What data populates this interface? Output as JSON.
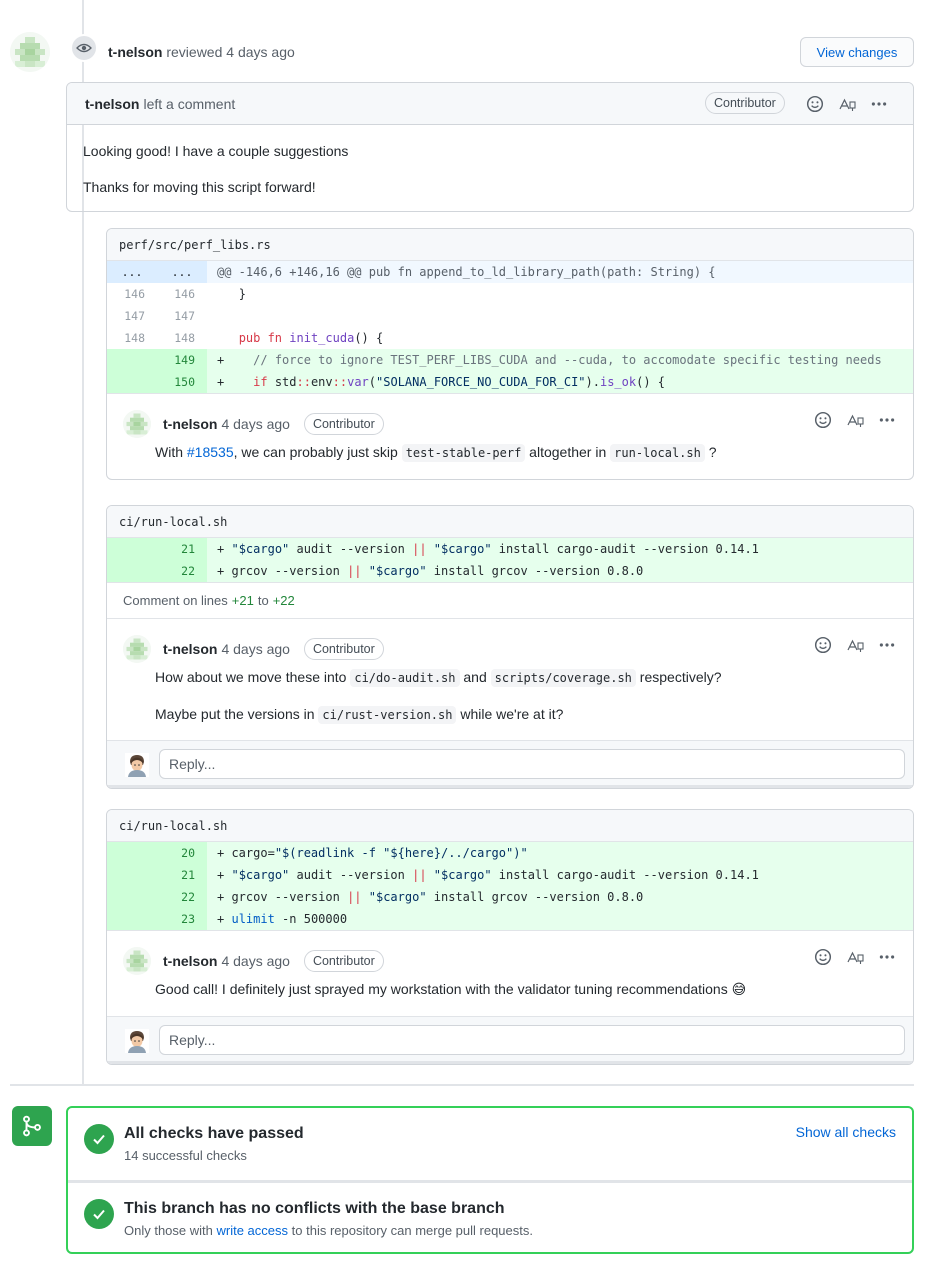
{
  "review": {
    "author": "t-nelson",
    "action": "reviewed",
    "time": "4 days ago",
    "view_changes_label": "View changes"
  },
  "main_comment": {
    "author": "t-nelson",
    "action": "left a comment",
    "badge": "Contributor",
    "paragraphs": [
      "Looking good! I have a couple suggestions",
      "Thanks for moving this script forward!"
    ]
  },
  "threads": [
    {
      "file": "perf/src/perf_libs.rs",
      "hunk_old": "...",
      "hunk_new": "...",
      "hunk": "@@ -146,6 +146,16 @@ pub fn append_to_ld_library_path(path: String) {",
      "lines": [
        {
          "old": "146",
          "new": "146",
          "sign": " ",
          "text": "}"
        },
        {
          "old": "147",
          "new": "147",
          "sign": " ",
          "text": ""
        },
        {
          "old": "148",
          "new": "148",
          "sign": " ",
          "text": "pub fn init_cuda() {"
        },
        {
          "old": "",
          "new": "149",
          "sign": "+",
          "text": "    // force to ignore TEST_PERF_LIBS_CUDA and --cuda, to accomodate specific testing needs"
        },
        {
          "old": "",
          "new": "150",
          "sign": "+",
          "text": "    if std::env::var(\"SOLANA_FORCE_NO_CUDA_FOR_CI\").is_ok() {"
        }
      ],
      "comment": {
        "author": "t-nelson",
        "time": "4 days ago",
        "badge": "Contributor",
        "t1": "With ",
        "link": "#18535",
        "t2": ", we can probably just skip ",
        "code1": "test-stable-perf",
        "t3": " altogether in ",
        "code2": "run-local.sh",
        "t4": " ?"
      }
    },
    {
      "file": "ci/run-local.sh",
      "lines": [
        {
          "old": "",
          "new": "21",
          "sign": "+",
          "text": "\"$cargo\" audit --version || \"$cargo\" install cargo-audit --version 0.14.1"
        },
        {
          "old": "",
          "new": "22",
          "sign": "+",
          "text": "grcov --version || \"$cargo\" install grcov --version 0.8.0"
        }
      ],
      "comment_on": {
        "prefix": "Comment on lines",
        "from": "+21",
        "to_word": "to",
        "to": "+22"
      },
      "comment": {
        "author": "t-nelson",
        "time": "4 days ago",
        "badge": "Contributor",
        "p1_a": "How about we move these into ",
        "p1_code1": "ci/do-audit.sh",
        "p1_b": " and ",
        "p1_code2": "scripts/coverage.sh",
        "p1_c": " respectively?",
        "p2_a": "Maybe put the versions in ",
        "p2_code": "ci/rust-version.sh",
        "p2_b": " while we're at it?"
      },
      "reply_placeholder": "Reply..."
    },
    {
      "file": "ci/run-local.sh",
      "lines": [
        {
          "old": "",
          "new": "20",
          "sign": "+",
          "text": "cargo=\"$(readlink -f \"${here}/../cargo\")\""
        },
        {
          "old": "",
          "new": "21",
          "sign": "+",
          "text": "\"$cargo\" audit --version || \"$cargo\" install cargo-audit --version 0.14.1"
        },
        {
          "old": "",
          "new": "22",
          "sign": "+",
          "text": "grcov --version || \"$cargo\" install grcov --version 0.8.0"
        },
        {
          "old": "",
          "new": "23",
          "sign": "+",
          "text": "ulimit -n 500000"
        }
      ],
      "comment": {
        "author": "t-nelson",
        "time": "4 days ago",
        "badge": "Contributor",
        "text": "Good call! I definitely just sprayed my workstation with the validator tuning recommendations 😅"
      },
      "reply_placeholder": "Reply..."
    }
  ],
  "merge": {
    "checks_title": "All checks have passed",
    "checks_sub": "14 successful checks",
    "show_all": "Show all checks",
    "conflict_title": "This branch has no conflicts with the base branch",
    "conflict_sub_a": "Only those with ",
    "conflict_sub_link": "write access",
    "conflict_sub_b": " to this repository can merge pull requests."
  },
  "icons": {
    "eye": "eye-icon",
    "smiley": "smiley-icon",
    "translate": "translate-icon",
    "more": "kebab-horizontal-icon",
    "check": "check-icon",
    "merge": "git-merge-icon"
  },
  "colors": {
    "link": "#0366d6",
    "success": "#2ea44f",
    "add_bg": "#e6ffed",
    "add_num_bg": "#cdffd8",
    "hunk_bg": "#f1f8ff"
  }
}
